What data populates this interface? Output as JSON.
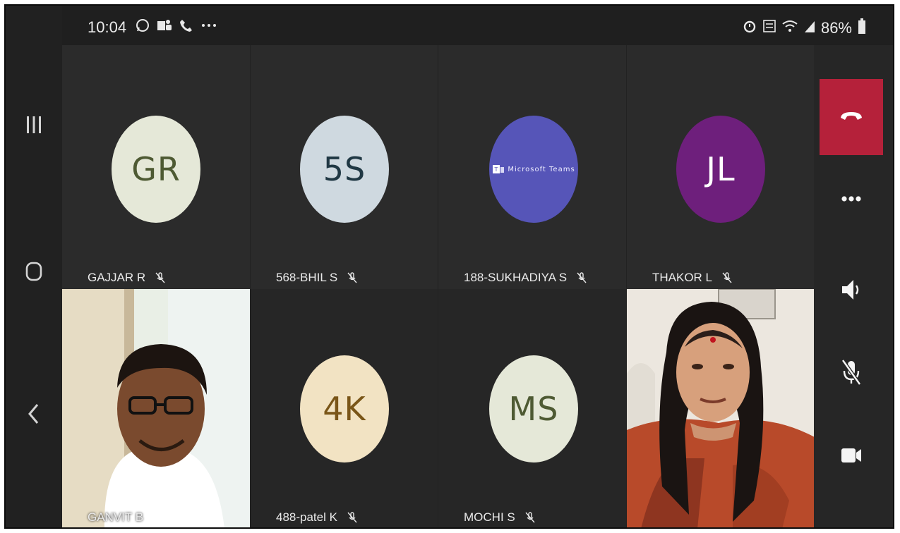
{
  "status_bar": {
    "time": "10:04",
    "battery": "86%"
  },
  "participants": [
    {
      "initials": "GR",
      "name": "GAJJAR R",
      "avatar_bg": "#e5e8d8",
      "avatar_fg": "#4e5a33",
      "muted": true
    },
    {
      "initials": "5S",
      "name": "568-BHIL S",
      "avatar_bg": "#cfd9e0",
      "avatar_fg": "#203844",
      "muted": true
    },
    {
      "initials": "",
      "name": "188-SUKHADIYA S",
      "avatar_bg": "#5655b8",
      "avatar_fg": "#ffffff",
      "muted": true,
      "logo_text": "Microsoft Teams"
    },
    {
      "initials": "JL",
      "name": "THAKOR L",
      "avatar_bg": "#6e1f7c",
      "avatar_fg": "#ffffff",
      "muted": true
    },
    {
      "initials": "",
      "name": "GANVIT B",
      "video": true,
      "muted": false
    },
    {
      "initials": "4K",
      "name": "488-patel K",
      "avatar_bg": "#f2e3c3",
      "avatar_fg": "#7a5618",
      "muted": true
    },
    {
      "initials": "MS",
      "name": "MOCHI S",
      "avatar_bg": "#e5e8d8",
      "avatar_fg": "#4e5a33",
      "muted": true
    },
    {
      "initials": "",
      "name": "",
      "video": true,
      "muted": false
    }
  ],
  "colors": {
    "hangup": "#b5213a",
    "background": "#222222"
  },
  "icons": {
    "nav": [
      "recent-apps-icon",
      "home-icon",
      "back-icon"
    ],
    "controls": [
      "hang-up-icon",
      "more-icon",
      "speaker-icon",
      "mic-off-icon",
      "video-camera-icon"
    ]
  }
}
